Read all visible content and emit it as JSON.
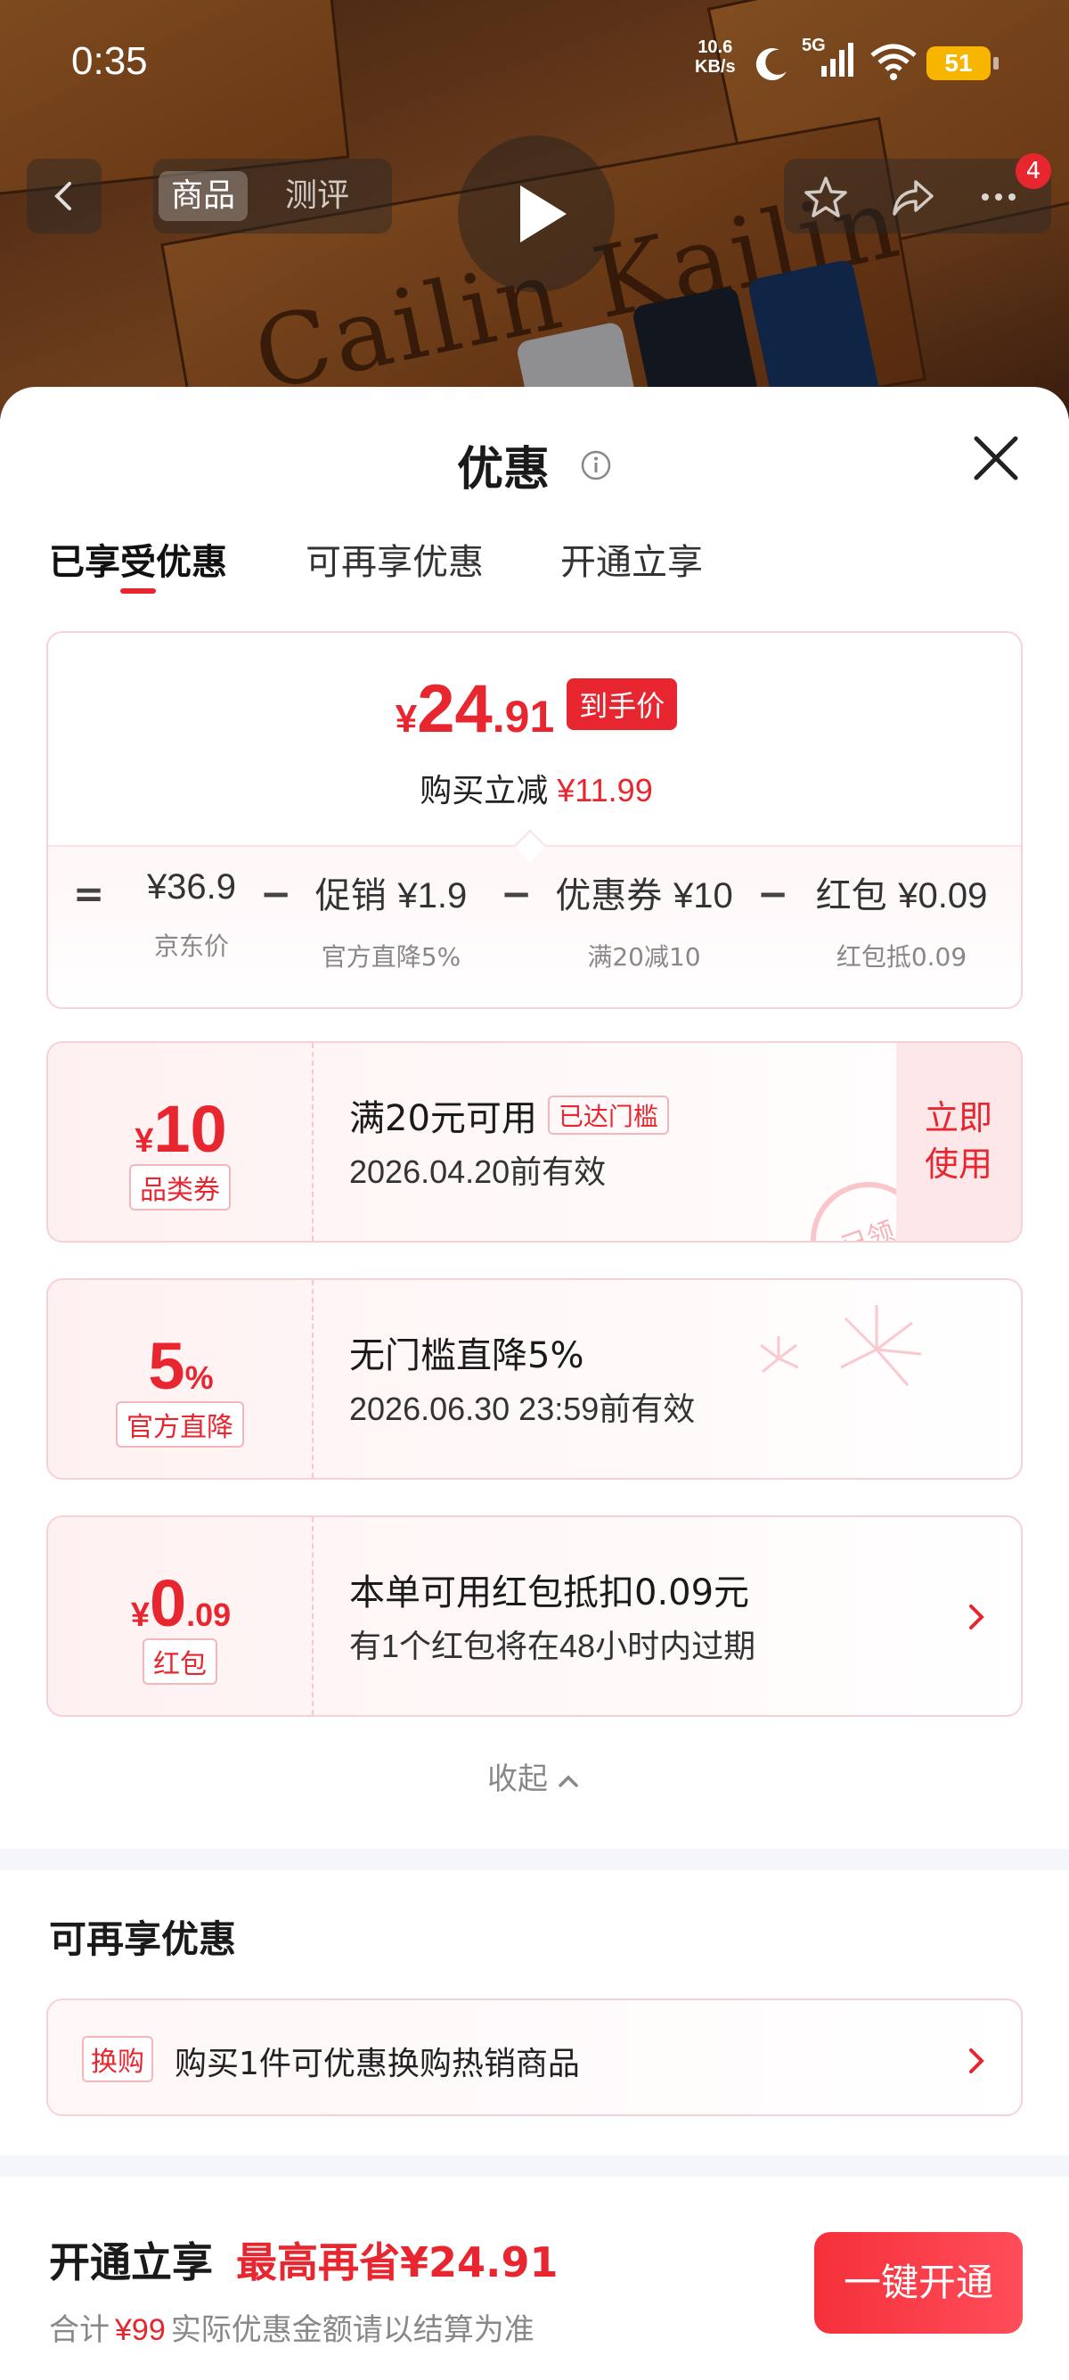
{
  "status_bar": {
    "time": "0:35",
    "net_speed_value": "10.6",
    "net_speed_unit": "KB/s",
    "network": "5G",
    "battery": "51"
  },
  "product_nav": {
    "tabs": [
      "商品",
      "测评"
    ],
    "active_tab": 0,
    "cart_badge": "4",
    "brand_text": "Cailin Kailin"
  },
  "sheet": {
    "title": "优惠",
    "tabs": [
      "已享受优惠",
      "可再享优惠",
      "开通立享"
    ],
    "active_tab": 0
  },
  "summary": {
    "price_yen": "¥",
    "price_int": "24",
    "price_dec": ".91",
    "price_tag": "到手价",
    "save_label": "购买立减",
    "save_amount": "¥11.99",
    "breakdown": [
      {
        "op": "=",
        "label": "",
        "value": "¥36.9",
        "sub": "京东价"
      },
      {
        "op": "−",
        "label": "促销",
        "value": "¥1.9",
        "sub": "官方直降5%"
      },
      {
        "op": "−",
        "label": "优惠券",
        "value": "¥10",
        "sub": "满20减10"
      },
      {
        "op": "−",
        "label": "红包",
        "value": "¥0.09",
        "sub": "红包抵0.09"
      }
    ]
  },
  "coupons": [
    {
      "amount_prefix": "¥",
      "amount_main": "10",
      "amount_suffix": "",
      "label": "品类券",
      "title": "满20元可用",
      "badge": "已达门槛",
      "subtitle": "2026.04.20前有效",
      "action": "立即使用",
      "action_line1": "立即",
      "action_line2": "使用",
      "stamp": "已领"
    },
    {
      "amount_prefix": "",
      "amount_main": "5",
      "amount_suffix": "%",
      "label": "官方直降",
      "title": "无门槛直降5%",
      "subtitle": "2026.06.30 23:59前有效"
    },
    {
      "amount_prefix": "¥",
      "amount_main": "0",
      "amount_suffix": ".09",
      "label": "红包",
      "title": "本单可用红包抵扣0.09元",
      "subtitle": "有1个红包将在48小时内过期"
    }
  ],
  "collapse_label": "收起",
  "more_section": {
    "title": "可再享优惠",
    "tag": "换购",
    "text": "购买1件可优惠换购热销商品"
  },
  "open_section": {
    "title": "开通立享",
    "highlight": "最高再省¥24.91",
    "sub_prefix": "合计",
    "sub_amount": "¥99",
    "sub_suffix": "实际优惠金额请以结算为准",
    "button": "一键开通"
  },
  "colors": {
    "accent": "#e8262f",
    "card_border": "#f5d2d5",
    "muted_text": "#888888"
  },
  "icons": [
    "back-icon",
    "star-icon",
    "share-icon",
    "more-icon",
    "play-icon",
    "info-icon",
    "close-icon",
    "chevron-up-icon",
    "chevron-right-icon",
    "moon-icon",
    "signal-icon",
    "wifi-icon"
  ]
}
